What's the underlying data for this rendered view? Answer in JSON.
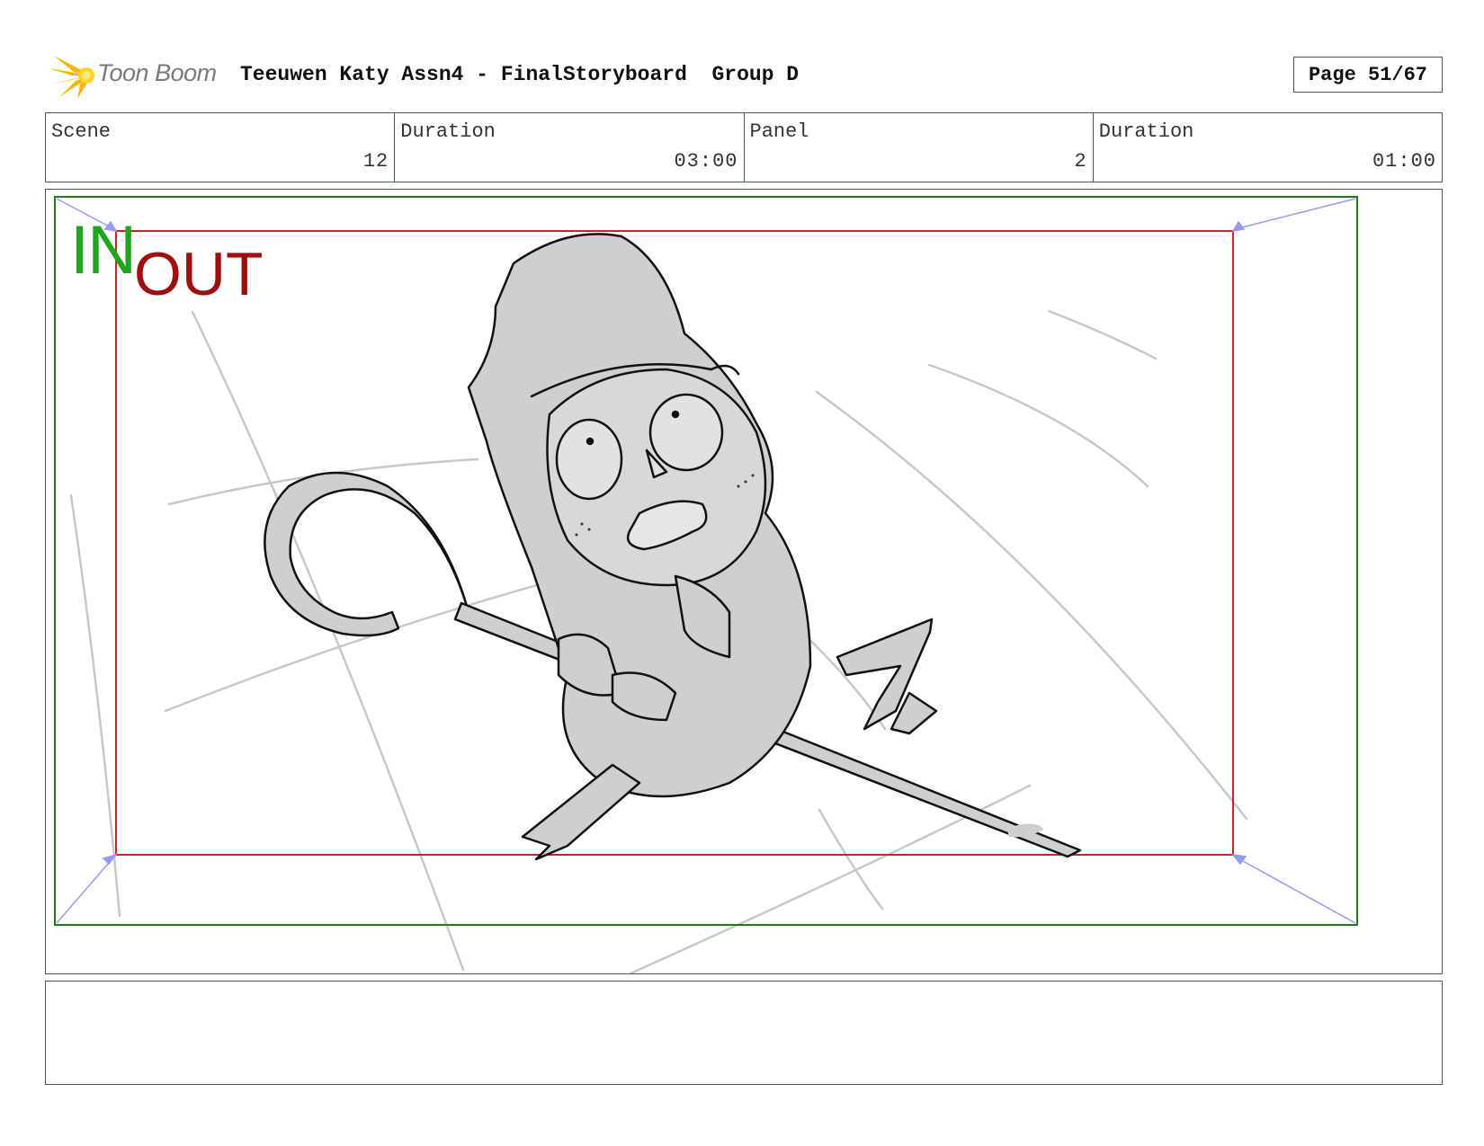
{
  "header": {
    "logo_text": "Toon Boom",
    "title": "Teeuwen Katy Assn4 - FinalStoryboard  Group D",
    "page": "Page 51/67"
  },
  "info": {
    "scene_label": "Scene",
    "scene_value": "12",
    "scene_duration_label": "Duration",
    "scene_duration_value": "03:00",
    "panel_label": "Panel",
    "panel_value": "2",
    "panel_duration_label": "Duration",
    "panel_duration_value": "01:00"
  },
  "panel": {
    "in_label": "IN",
    "out_label": "OUT",
    "in_frame_color": "#1f7a1f",
    "out_frame_color": "#c0262c",
    "camera_arrow_color": "#9999ee"
  },
  "notes": {
    "text": ""
  }
}
